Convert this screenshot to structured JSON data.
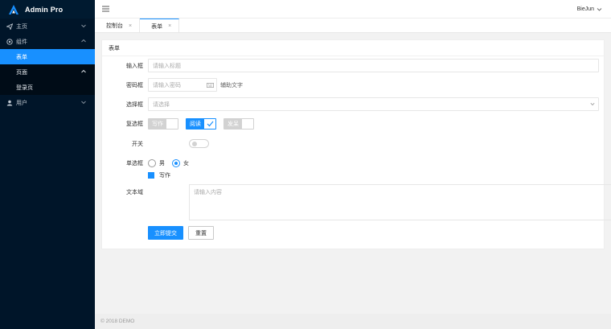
{
  "brand": {
    "name": "Admin Pro"
  },
  "sidebar": {
    "items": [
      {
        "label": "主页",
        "icon": "send-icon"
      },
      {
        "label": "组件",
        "icon": "settings-icon"
      },
      {
        "label": "表单"
      },
      {
        "label": "页面"
      },
      {
        "label": "登录页"
      },
      {
        "label": "用户",
        "icon": "user-icon"
      }
    ]
  },
  "header": {
    "user": "BieJun"
  },
  "tabs": [
    {
      "label": "控制台"
    },
    {
      "label": "表单"
    }
  ],
  "form": {
    "title": "表单",
    "input": {
      "label": "输入框",
      "placeholder": "请输入标题"
    },
    "password": {
      "label": "密码框",
      "placeholder": "请输入密码",
      "aux": "辅助文字"
    },
    "select": {
      "label": "选择框",
      "placeholder": "请选择"
    },
    "checkbox": {
      "label": "复选框",
      "options": [
        "写作",
        "阅读",
        "发呆"
      ],
      "checked": "阅读"
    },
    "switch": {
      "label": "开关",
      "on": false
    },
    "radio": {
      "label": "单选框",
      "options": [
        "男",
        "女"
      ],
      "selected": "女"
    },
    "primary_checkbox": {
      "label": "写作",
      "checked": true
    },
    "textarea": {
      "label": "文本域",
      "placeholder": "请输入内容"
    },
    "submit": "立即提交",
    "reset": "重置"
  },
  "footer": {
    "text": "© 2018 DEMO"
  },
  "colors": {
    "accent": "#1890ff",
    "sidebar": "#001529"
  }
}
